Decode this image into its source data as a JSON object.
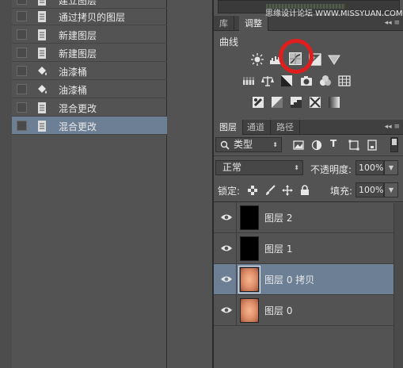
{
  "history": {
    "items": [
      {
        "label": "建立图层",
        "icon": "document-icon"
      },
      {
        "label": "通过拷贝的图层",
        "icon": "document-icon"
      },
      {
        "label": "新建图层",
        "icon": "document-icon"
      },
      {
        "label": "新建图层",
        "icon": "document-icon"
      },
      {
        "label": "油漆桶",
        "icon": "paint-bucket-icon"
      },
      {
        "label": "油漆桶",
        "icon": "paint-bucket-icon"
      },
      {
        "label": "混合更改",
        "icon": "document-icon"
      },
      {
        "label": "混合更改",
        "icon": "document-icon",
        "selected": true
      }
    ]
  },
  "top_tabs": {
    "library": "库",
    "adjustments": "调整"
  },
  "watermark": "思缘设计论坛 WWW.MISSYUAN.COM",
  "adjustments": {
    "hover_title": "曲线",
    "highlighted": "curves-icon",
    "rows": [
      [
        "brightness-contrast-icon",
        "levels-icon",
        "curves-icon",
        "exposure-icon",
        "vibrance-icon"
      ],
      [
        "hue-saturation-icon",
        "color-balance-icon",
        "black-white-icon",
        "photo-filter-icon",
        "channel-mixer-icon",
        "color-lookup-icon"
      ],
      [
        "invert-icon",
        "posterize-icon",
        "threshold-icon",
        "selective-color-icon",
        "gradient-map-icon"
      ]
    ],
    "highlight_color": "#e01e1e"
  },
  "layers_tabs": {
    "layers": "图层",
    "channels": "通道",
    "paths": "路径"
  },
  "filter": {
    "kind_label": "类型"
  },
  "blend": {
    "mode": "正常",
    "opacity_label": "不透明度:",
    "opacity": "100%"
  },
  "lock": {
    "label": "锁定:",
    "fill_label": "填充:",
    "fill": "100%"
  },
  "layers": [
    {
      "name": "图层 2",
      "thumb": "black",
      "visible": true
    },
    {
      "name": "图层 1",
      "thumb": "black",
      "visible": true
    },
    {
      "name": "图层 0 拷贝",
      "thumb": "face",
      "visible": true,
      "selected": true
    },
    {
      "name": "图层 0",
      "thumb": "face",
      "visible": true
    }
  ],
  "colors": {
    "selection": "#6d7f95",
    "panel": "#535353"
  }
}
